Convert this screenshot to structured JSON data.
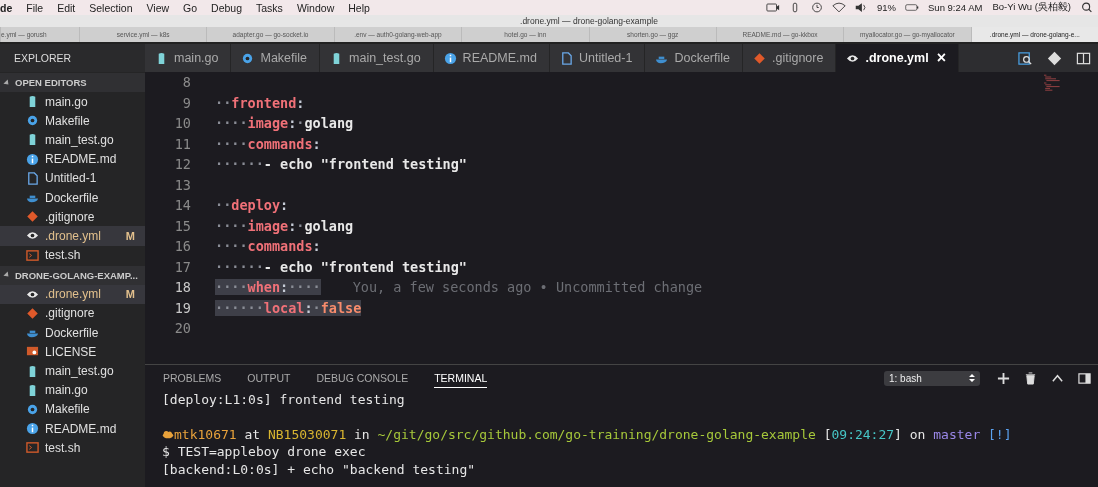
{
  "menu_bar": {
    "items": [
      "de",
      "File",
      "Edit",
      "Selection",
      "View",
      "Go",
      "Debug",
      "Tasks",
      "Window",
      "Help"
    ],
    "battery": "91%",
    "clock": "Sun 9:24 AM",
    "user": "Bo-Yi Wu (吳柏毅)"
  },
  "window": {
    "title": ".drone.yml — drone-golang-example"
  },
  "window_tabs": [
    {
      "label": "e.yml — gorush",
      "selected": false
    },
    {
      "label": "service.yml — k8s",
      "selected": false
    },
    {
      "label": "adapter.go — go-socket.io",
      "selected": false
    },
    {
      "label": ".env — auth0-golang-web-app",
      "selected": false
    },
    {
      "label": "hotel.go — inn",
      "selected": false
    },
    {
      "label": "shorten.go — ggz",
      "selected": false
    },
    {
      "label": "README.md — go-kkbox",
      "selected": false
    },
    {
      "label": "myallocator.go — go-myallocator",
      "selected": false
    },
    {
      "label": ".drone.yml — drone-golang-e...",
      "selected": true
    }
  ],
  "sidebar": {
    "title": "EXPLORER",
    "sections": [
      {
        "title": "OPEN EDITORS",
        "expanded": true,
        "items": [
          {
            "label": "main.go",
            "kind": "go",
            "selected": false
          },
          {
            "label": "Makefile",
            "kind": "gear",
            "selected": false
          },
          {
            "label": "main_test.go",
            "kind": "go",
            "selected": false
          },
          {
            "label": "README.md",
            "kind": "info",
            "selected": false
          },
          {
            "label": "Untitled-1",
            "kind": "file",
            "selected": false
          },
          {
            "label": "Dockerfile",
            "kind": "docker",
            "selected": false
          },
          {
            "label": ".gitignore",
            "kind": "git",
            "selected": false
          },
          {
            "label": ".drone.yml",
            "kind": "eye",
            "selected": true,
            "badge": "M"
          },
          {
            "label": "test.sh",
            "kind": "terminal",
            "selected": false
          }
        ]
      },
      {
        "title": "DRONE-GOLANG-EXAMP...",
        "expanded": true,
        "items": [
          {
            "label": ".drone.yml",
            "kind": "eye",
            "selected": true,
            "badge": "M"
          },
          {
            "label": ".gitignore",
            "kind": "git",
            "selected": false
          },
          {
            "label": "Dockerfile",
            "kind": "docker",
            "selected": false
          },
          {
            "label": "LICENSE",
            "kind": "license",
            "selected": false
          },
          {
            "label": "main_test.go",
            "kind": "go",
            "selected": false
          },
          {
            "label": "main.go",
            "kind": "go",
            "selected": false
          },
          {
            "label": "Makefile",
            "kind": "gear",
            "selected": false
          },
          {
            "label": "README.md",
            "kind": "info",
            "selected": false
          },
          {
            "label": "test.sh",
            "kind": "terminal",
            "selected": false
          }
        ]
      }
    ]
  },
  "editor_tabs": [
    {
      "label": "main.go",
      "kind": "go",
      "selected": false
    },
    {
      "label": "Makefile",
      "kind": "gear",
      "selected": false
    },
    {
      "label": "main_test.go",
      "kind": "go",
      "selected": false
    },
    {
      "label": "README.md",
      "kind": "info",
      "selected": false
    },
    {
      "label": "Untitled-1",
      "kind": "file",
      "selected": false
    },
    {
      "label": "Dockerfile",
      "kind": "docker",
      "selected": false
    },
    {
      "label": ".gitignore",
      "kind": "git",
      "selected": false
    },
    {
      "label": ".drone.yml",
      "kind": "eye",
      "selected": true,
      "close": "×"
    }
  ],
  "code_lines": [
    {
      "number": "8",
      "selected": false
    },
    {
      "number": "9",
      "selected": false,
      "tokens": [
        {
          "kind": "ws",
          "text": "··"
        },
        {
          "kind": "key",
          "text": "frontend"
        },
        {
          "kind": "punct",
          "text": ":"
        }
      ]
    },
    {
      "number": "10",
      "selected": false,
      "tokens": [
        {
          "kind": "ws",
          "text": "····"
        },
        {
          "kind": "key",
          "text": "image"
        },
        {
          "kind": "punct",
          "text": ":"
        },
        {
          "kind": "ws",
          "text": "·"
        },
        {
          "kind": "plain",
          "text": "golang"
        }
      ]
    },
    {
      "number": "11",
      "selected": false,
      "tokens": [
        {
          "kind": "ws",
          "text": "····"
        },
        {
          "kind": "key",
          "text": "commands"
        },
        {
          "kind": "punct",
          "text": ":"
        }
      ]
    },
    {
      "number": "12",
      "selected": false,
      "tokens": [
        {
          "kind": "ws",
          "text": "······"
        },
        {
          "kind": "plain",
          "text": "- echo \"frontend testing\""
        }
      ]
    },
    {
      "number": "13",
      "selected": false
    },
    {
      "number": "14",
      "selected": false,
      "tokens": [
        {
          "kind": "ws",
          "text": "··"
        },
        {
          "kind": "key",
          "text": "deploy"
        },
        {
          "kind": "punct",
          "text": ":"
        }
      ]
    },
    {
      "number": "15",
      "selected": false,
      "tokens": [
        {
          "kind": "ws",
          "text": "····"
        },
        {
          "kind": "key",
          "text": "image"
        },
        {
          "kind": "punct",
          "text": ":"
        },
        {
          "kind": "ws",
          "text": "·"
        },
        {
          "kind": "plain",
          "text": "golang"
        }
      ]
    },
    {
      "number": "16",
      "selected": false,
      "tokens": [
        {
          "kind": "ws",
          "text": "····"
        },
        {
          "kind": "key",
          "text": "commands"
        },
        {
          "kind": "punct",
          "text": ":"
        }
      ]
    },
    {
      "number": "17",
      "selected": false,
      "tokens": [
        {
          "kind": "ws",
          "text": "······"
        },
        {
          "kind": "plain",
          "text": "- echo \"frontend testing\""
        }
      ]
    },
    {
      "number": "18",
      "selected": true,
      "tokens": [
        {
          "kind": "ws",
          "text": "····"
        },
        {
          "kind": "key",
          "text": "when"
        },
        {
          "kind": "punct",
          "text": ":"
        },
        {
          "kind": "ws",
          "text": "····"
        }
      ],
      "blame": "You, a few seconds ago • Uncommitted change"
    },
    {
      "number": "19",
      "selected": true,
      "tokens": [
        {
          "kind": "ws",
          "text": "······"
        },
        {
          "kind": "key",
          "text": "local"
        },
        {
          "kind": "punct",
          "text": ":"
        },
        {
          "kind": "ws",
          "text": "·"
        },
        {
          "kind": "bool",
          "text": "false"
        }
      ]
    },
    {
      "number": "20",
      "selected": false
    }
  ],
  "panel": {
    "tabs": [
      {
        "label": "PROBLEMS",
        "selected": false
      },
      {
        "label": "OUTPUT",
        "selected": false
      },
      {
        "label": "DEBUG CONSOLE",
        "selected": false
      },
      {
        "label": "TERMINAL",
        "selected": true
      }
    ],
    "terminal_select": "1: bash",
    "terminal_lines": [
      {
        "kind": "text",
        "segments": [
          {
            "kind": "plain",
            "text": "[deploy:L1:0s] frontend testing"
          }
        ]
      },
      {
        "kind": "blank"
      },
      {
        "kind": "prompt",
        "segments": [
          {
            "kind": "orange",
            "text": "mtk10671"
          },
          {
            "kind": "plain",
            "text": " at "
          },
          {
            "kind": "yellow",
            "text": "NB15030071"
          },
          {
            "kind": "plain",
            "text": " in "
          },
          {
            "kind": "green",
            "text": "~/git/go/src/github.com/go-training/drone-golang-example"
          },
          {
            "kind": "plain",
            "text": " ["
          },
          {
            "kind": "cyan",
            "text": "09:24:27"
          },
          {
            "kind": "plain",
            "text": "] on "
          },
          {
            "kind": "purple",
            "text": "master"
          },
          {
            "kind": "blue",
            "text": " [!]"
          }
        ]
      },
      {
        "kind": "text",
        "segments": [
          {
            "kind": "plain",
            "text": "$ TEST=appleboy drone exec"
          }
        ]
      },
      {
        "kind": "text",
        "segments": [
          {
            "kind": "plain",
            "text": "[backend:L0:0s] + echo \"backend testing\""
          }
        ]
      }
    ]
  }
}
